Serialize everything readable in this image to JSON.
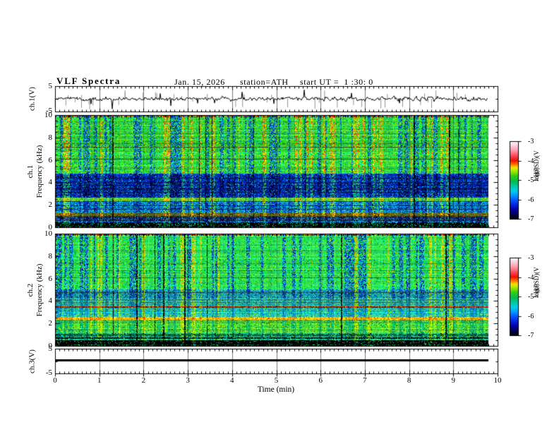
{
  "header": {
    "title": "VLF Spectra",
    "date": "Jan. 15, 2026",
    "station": "station=ATH",
    "start_ut": "start UT =  1 :30: 0"
  },
  "x_axis": {
    "label": "Time (min)",
    "min": 0,
    "max": 10,
    "major_ticks": [
      "0",
      "1",
      "2",
      "3",
      "4",
      "5",
      "6",
      "7",
      "8",
      "9",
      "10"
    ],
    "minor_per_major": 10,
    "data_end_min": 9.8
  },
  "colorbar": {
    "label_parts": [
      "log(PSD)(V",
      "2",
      "/Hz)"
    ],
    "ticks": [
      "-3",
      "-4",
      "-5",
      "-6",
      "-7"
    ],
    "max": -3,
    "min": -7,
    "gradient_stops": [
      [
        0.0,
        "#ffffff"
      ],
      [
        0.05,
        "#ffd5dd"
      ],
      [
        0.12,
        "#ff99aa"
      ],
      [
        0.19,
        "#ff4455"
      ],
      [
        0.25,
        "#ee1100"
      ],
      [
        0.3,
        "#ff7700"
      ],
      [
        0.34,
        "#ffdd00"
      ],
      [
        0.38,
        "#aaee00"
      ],
      [
        0.45,
        "#33cc11"
      ],
      [
        0.52,
        "#00bb55"
      ],
      [
        0.58,
        "#00c9a0"
      ],
      [
        0.64,
        "#00ccee"
      ],
      [
        0.7,
        "#0099ff"
      ],
      [
        0.76,
        "#0055ff"
      ],
      [
        0.82,
        "#0022dd"
      ],
      [
        0.88,
        "#0000aa"
      ],
      [
        0.94,
        "#000055"
      ],
      [
        1.0,
        "#000000"
      ]
    ]
  },
  "chart_data": [
    {
      "id": "ch1_waveform",
      "type": "line",
      "ylabel": "ch.1(V)",
      "ylim": [
        -5,
        5
      ],
      "yticks": [
        "5",
        "-5"
      ],
      "signal": {
        "baseline": 0,
        "noise_amp": 0.7,
        "spike_rate": 0.018,
        "spike_amp_max": 4.5,
        "color": "#000000",
        "spike_color": "#909090"
      }
    },
    {
      "id": "ch1_spectrogram",
      "type": "heatmap",
      "ylabel_lines": [
        "ch.1",
        "Frequency (kHz)"
      ],
      "ylim": [
        0,
        10
      ],
      "yticks": [
        "10",
        "8",
        "6",
        "4",
        "2",
        "0"
      ],
      "unit": "kHz",
      "value_range_log_psd": [
        -7,
        -3
      ],
      "hmarker": {
        "f": 6.1,
        "color": "#554411"
      },
      "columns": {
        "hot_p": 0.13,
        "cold_p": 0.18,
        "black_p": 0.035
      },
      "bands": [
        {
          "f": [
            9.8,
            10
          ],
          "base": [
            "#ff3300",
            "#ffcc00",
            "#00ccff",
            "#33dd33",
            "#ff8800",
            "#0033cc"
          ],
          "speck": [
            [
              "#000000",
              0.1
            ]
          ],
          "hot": [
            "#ff2200"
          ],
          "cold": [
            "#0044cc"
          ],
          "hline_p": 0,
          "hline_color": "#000000"
        },
        {
          "f": [
            4.8,
            9.8
          ],
          "base": [
            "#22cc44",
            "#33dd33",
            "#11bb55",
            "#55dd22"
          ],
          "speck": [
            [
              "#00ddbb",
              0.06
            ],
            [
              "#bbee00",
              0.08
            ],
            [
              "#006633",
              0.04
            ]
          ],
          "hot": [
            "#eedd00",
            "#ff9900",
            "#ff3300",
            "#ccee00"
          ],
          "cold": [
            "#00aadd",
            "#0044cc",
            "#002299"
          ],
          "hline_p": 0.02,
          "hline_color": "#335522"
        },
        {
          "f": [
            2.65,
            4.8
          ],
          "base": [
            "#0022bb",
            "#0033cc",
            "#001188",
            "#0044cc"
          ],
          "speck": [
            [
              "#00bbee",
              0.1
            ],
            [
              "#000022",
              0.1
            ],
            [
              "#33cc66",
              0.02
            ]
          ],
          "hot": [
            "#22bb66",
            "#44cc44",
            "#00aa88"
          ],
          "cold": [
            "#000066",
            "#000033"
          ],
          "hline_p": 0.1,
          "hline_color": "#001155"
        },
        {
          "f": [
            2.3,
            2.65
          ],
          "base": [
            "#55cc22",
            "#99dd22",
            "#33bb44"
          ],
          "speck": [
            [
              "#ffcc00",
              0.05
            ],
            [
              "#227711",
              0.06
            ]
          ],
          "hot": [
            "#ffee00",
            "#ff8800"
          ],
          "cold": [
            "#22aa99"
          ],
          "hline_p": 0.05,
          "hline_color": "#446600"
        },
        {
          "f": [
            1.35,
            2.3
          ],
          "base": [
            "#0066cc",
            "#0099ee",
            "#0044bb",
            "#00bbdd"
          ],
          "speck": [
            [
              "#33dd55",
              0.1
            ],
            [
              "#001166",
              0.08
            ]
          ],
          "hot": [
            "#33cc66",
            "#aadd00"
          ],
          "cold": [
            "#0022aa"
          ],
          "hline_p": 0.12,
          "hline_color": "#002266"
        },
        {
          "f": [
            0.95,
            1.35
          ],
          "base": [
            "#667700",
            "#885511",
            "#445500",
            "#99aa00"
          ],
          "speck": [
            [
              "#dd3300",
              0.04
            ],
            [
              "#111100",
              0.08
            ]
          ],
          "hot": [
            "#ffaa00"
          ],
          "cold": [
            "#336655"
          ],
          "hline_p": 0.15,
          "hline_color": "#221a00"
        },
        {
          "f": [
            0.45,
            0.95
          ],
          "base": [
            "#0055cc",
            "#0088ee",
            "#00aaff",
            "#0033aa"
          ],
          "speck": [
            [
              "#33dd66",
              0.07
            ],
            [
              "#000033",
              0.08
            ]
          ],
          "hot": [
            "#33bb88"
          ],
          "cold": [
            "#001188"
          ],
          "hline_p": 0.18,
          "hline_color": "#000022"
        },
        {
          "f": [
            0,
            0.45
          ],
          "base": [
            "#000000",
            "#000811",
            "#001100"
          ],
          "speck": [
            [
              "#00ee77",
              0.07
            ],
            [
              "#00bbee",
              0.05
            ]
          ],
          "hot": [
            "#005533"
          ],
          "cold": [
            "#000000"
          ],
          "hline_p": 0.5,
          "hline_color": "#000000"
        }
      ]
    },
    {
      "id": "ch2_spectrogram",
      "type": "heatmap",
      "ylabel_lines": [
        "ch.2",
        "Frequency (kHz)"
      ],
      "ylim": [
        0,
        10
      ],
      "yticks": [
        "10",
        "8",
        "6",
        "4",
        "2",
        "0"
      ],
      "unit": "kHz",
      "value_range_log_psd": [
        -7,
        -3
      ],
      "columns": {
        "hot_p": 0.08,
        "cold_p": 0.16,
        "black_p": 0.03
      },
      "bands": [
        {
          "f": [
            9.8,
            10
          ],
          "base": [
            "#ff3300",
            "#ffcc00",
            "#00ccff",
            "#33dd33",
            "#ff8800",
            "#0033cc"
          ],
          "speck": [
            [
              "#000000",
              0.1
            ]
          ],
          "hot": [
            "#ff2200"
          ],
          "cold": [
            "#0044cc"
          ],
          "hline_p": 0,
          "hline_color": "#000000"
        },
        {
          "f": [
            5.0,
            9.8
          ],
          "base": [
            "#22dd44",
            "#44ee33",
            "#11cc55",
            "#33dd66"
          ],
          "speck": [
            [
              "#00ddcc",
              0.08
            ],
            [
              "#ccee00",
              0.05
            ],
            [
              "#005533",
              0.03
            ]
          ],
          "hot": [
            "#ddee00",
            "#ffbb00"
          ],
          "cold": [
            "#00bbee",
            "#0044cc",
            "#000099"
          ],
          "hline_p": 0.02,
          "hline_color": "#336622"
        },
        {
          "f": [
            4.2,
            5.0
          ],
          "base": [
            "#00aacc",
            "#22bbaa",
            "#0077cc",
            "#33ccbb"
          ],
          "speck": [
            [
              "#003388",
              0.1
            ],
            [
              "#66ee44",
              0.08
            ]
          ],
          "hot": [
            "#aadd00"
          ],
          "cold": [
            "#0033aa"
          ],
          "hline_p": 0.1,
          "hline_color": "#114455"
        },
        {
          "f": [
            3.55,
            4.2
          ],
          "base": [
            "#22ccaa",
            "#33ddcc",
            "#00aadd",
            "#55dd88"
          ],
          "speck": [
            [
              "#006699",
              0.08
            ],
            [
              "#ffdd00",
              0.03
            ]
          ],
          "hot": [
            "#bbee00"
          ],
          "cold": [
            "#0088bb"
          ],
          "hline_p": 0.06,
          "hline_color": "#226655"
        },
        {
          "f": [
            3.38,
            3.55
          ],
          "base": [
            "#441100",
            "#662200",
            "#330000"
          ],
          "speck": [
            [
              "#ff2200",
              0.45
            ],
            [
              "#ff8800",
              0.15
            ]
          ],
          "hot": [
            "#ff4400"
          ],
          "cold": [
            "#551100"
          ],
          "hline_p": 0,
          "hline_color": "#000000"
        },
        {
          "f": [
            2.55,
            3.38
          ],
          "base": [
            "#00ccaa",
            "#33ddbb",
            "#00aaee",
            "#44dd77"
          ],
          "speck": [
            [
              "#0066aa",
              0.07
            ],
            [
              "#ccee00",
              0.05
            ]
          ],
          "hot": [
            "#aaee00"
          ],
          "cold": [
            "#0088cc"
          ],
          "hline_p": 0.07,
          "hline_color": "#117755"
        },
        {
          "f": [
            2.3,
            2.55
          ],
          "base": [
            "#ffcc00",
            "#ff9900",
            "#ddcc00",
            "#ffee33"
          ],
          "speck": [
            [
              "#ff3300",
              0.12
            ],
            [
              "#885500",
              0.08
            ]
          ],
          "hot": [
            "#ff6600"
          ],
          "cold": [
            "#cc9900"
          ],
          "hline_p": 0.08,
          "hline_color": "#884400"
        },
        {
          "f": [
            1.15,
            2.3
          ],
          "base": [
            "#33cc44",
            "#55dd33",
            "#22bb55",
            "#77dd22"
          ],
          "speck": [
            [
              "#ffee00",
              0.05
            ],
            [
              "#115511",
              0.05
            ]
          ],
          "hot": [
            "#ccee00"
          ],
          "cold": [
            "#00aa77"
          ],
          "hline_p": 0.18,
          "hline_color": "#445500"
        },
        {
          "f": [
            0.5,
            1.15
          ],
          "base": [
            "#22cc88",
            "#00bb99",
            "#44dd66",
            "#00ccbb"
          ],
          "speck": [
            [
              "#001122",
              0.08
            ],
            [
              "#bbee00",
              0.05
            ]
          ],
          "hot": [
            "#99dd00"
          ],
          "cold": [
            "#008877"
          ],
          "hline_p": 0.3,
          "hline_color": "#001111"
        },
        {
          "f": [
            0,
            0.5
          ],
          "base": [
            "#001100",
            "#000000",
            "#002211"
          ],
          "speck": [
            [
              "#00ee66",
              0.1
            ],
            [
              "#33ccbb",
              0.04
            ]
          ],
          "hot": [
            "#008844"
          ],
          "cold": [
            "#000000"
          ],
          "hline_p": 0.5,
          "hline_color": "#000000"
        }
      ]
    },
    {
      "id": "ch3_waveform",
      "type": "line",
      "ylabel": "ch.3(V)",
      "ylim": [
        -5,
        5
      ],
      "yticks": [
        "5",
        "-5"
      ],
      "signal": {
        "baseline": 0.55,
        "flat": true,
        "thickness": 3,
        "color": "#000000"
      }
    }
  ]
}
